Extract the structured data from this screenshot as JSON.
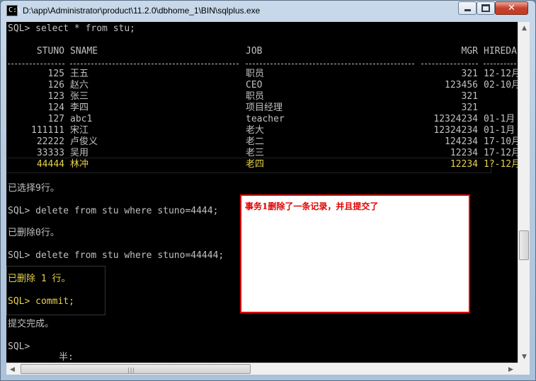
{
  "window": {
    "title": "D:\\app\\Administrator\\product\\11.2.0\\dbhome_1\\BIN\\sqlplus.exe",
    "icon": "console-app-icon",
    "buttons": [
      "minimize",
      "maximize",
      "close"
    ],
    "close_glyph": "✕"
  },
  "console": {
    "cmd1": "SQL> select * from stu;",
    "headers": {
      "stuno": "STUNO",
      "sname": "SNAME",
      "job": "JOB",
      "mgr": "MGR",
      "hiredate": "HIREDA"
    },
    "rows": [
      {
        "stuno": "125",
        "sname": "王五",
        "job": "职员",
        "mgr": "321",
        "hiredate": "12-12月"
      },
      {
        "stuno": "126",
        "sname": "赵六",
        "job": "CEO",
        "mgr": "123456",
        "hiredate": "02-10月"
      },
      {
        "stuno": "123",
        "sname": "张三",
        "job": "职员",
        "mgr": "321",
        "hiredate": ""
      },
      {
        "stuno": "124",
        "sname": "李四",
        "job": "项目经理",
        "mgr": "321",
        "hiredate": ""
      },
      {
        "stuno": "127",
        "sname": "abc1",
        "job": "teacher",
        "mgr": "12324234",
        "hiredate": "01-1月"
      },
      {
        "stuno": "111111",
        "sname": "宋江",
        "job": "老大",
        "mgr": "12324234",
        "hiredate": "01-1月"
      },
      {
        "stuno": "22222",
        "sname": "卢俊义",
        "job": "老二",
        "mgr": "124234",
        "hiredate": "17-10月"
      },
      {
        "stuno": "33333",
        "sname": "吴用",
        "job": "老三",
        "mgr": "12234",
        "hiredate": "17-12月"
      },
      {
        "stuno": "44444",
        "sname": "林冲",
        "job": "老四",
        "mgr": "12234",
        "hiredate": "1?-12月"
      }
    ],
    "selected_msg": "已选择9行。",
    "cmd2": "SQL> delete from stu where stuno=4444;",
    "deleted0": "已删除0行。",
    "cmd3": "SQL> delete from stu where stuno=44444;",
    "deleted1": "已删除 1 行。",
    "cmd4": "SQL> commit;",
    "commit_done": "提交完成。",
    "prompt": "SQL>",
    "ime_text": "半:",
    "highlight_color": "#e6d24a"
  },
  "annotation": {
    "text": "事务1删除了一条记录，并且提交了",
    "color": "#e00000"
  },
  "scrollbars": {
    "up": "▲",
    "down": "▼",
    "left": "◀",
    "right": "▶",
    "grip": "|||"
  }
}
